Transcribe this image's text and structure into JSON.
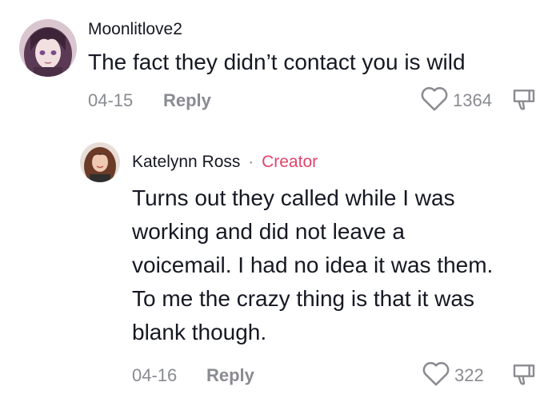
{
  "comments": [
    {
      "username": "Moonlitlove2",
      "text": "The fact they didn’t contact you is wild",
      "date": "04-15",
      "reply_label": "Reply",
      "likes": "1364",
      "avatar_icon": "anime-girl-avatar",
      "is_creator": false
    }
  ],
  "reply": {
    "username": "Katelynn Ross",
    "separator": "·",
    "badge": "Creator",
    "text_lines": [
      "Turns out they called while I was",
      "working and did not leave a",
      "voicemail. I had no idea it was them.",
      "To me the crazy thing is that it was",
      "blank though."
    ],
    "date": "04-16",
    "reply_label": "Reply",
    "likes": "322",
    "avatar_icon": "woman-avatar"
  },
  "colors": {
    "text": "#161823",
    "muted": "#8a8b91",
    "creator": "#e0456b"
  }
}
